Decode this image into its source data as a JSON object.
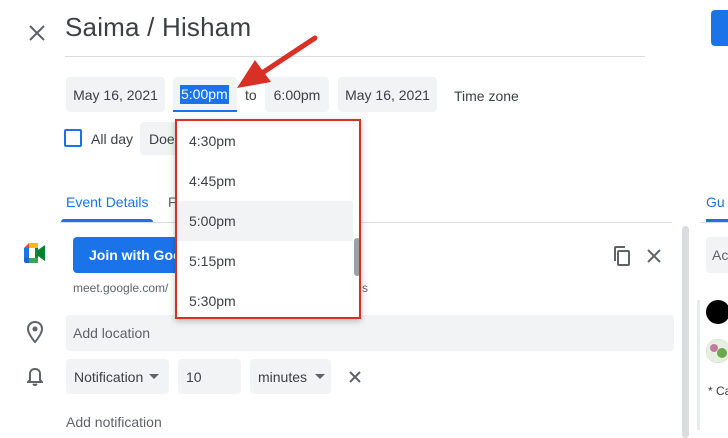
{
  "header": {
    "title": "Saima / Hisham"
  },
  "datetime": {
    "start_date": "May 16, 2021",
    "start_time": "5:00pm",
    "to_label": "to",
    "end_time": "6:00pm",
    "end_date": "May 16, 2021",
    "timezone_label": "Time zone",
    "all_day_label": "All day",
    "repeat_value": "Doe"
  },
  "time_dropdown": {
    "options": [
      "4:30pm",
      "4:45pm",
      "5:00pm",
      "5:15pm",
      "5:30pm"
    ],
    "highlighted": "5:00pm"
  },
  "tabs": {
    "event_details": "Event Details",
    "second_partial": "F",
    "guests_partial": "Gu"
  },
  "meet": {
    "join_label": "Join with Goo",
    "link_partial": "meet.google.com/",
    "link_tail": "s"
  },
  "location": {
    "placeholder": "Add location"
  },
  "notification": {
    "type": "Notification",
    "value": "10",
    "unit": "minutes",
    "add_label": "Add notification"
  },
  "guests": {
    "input_partial": "Ac",
    "note_partial": "* Ca"
  },
  "colors": {
    "accent": "#1a73e8",
    "annotation": "#d93025",
    "chip_bg": "#f1f3f4"
  }
}
